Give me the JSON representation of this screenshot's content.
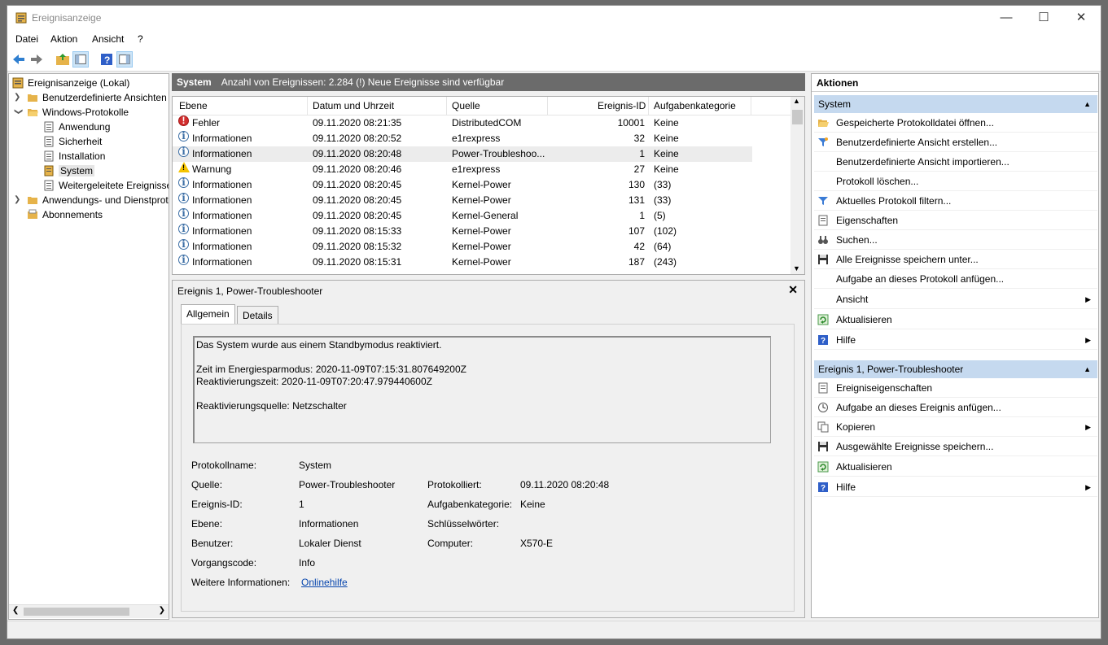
{
  "window": {
    "title": "Ereignisanzeige",
    "minimize": "—",
    "maximize": "☐",
    "close": "✕"
  },
  "menu": [
    "Datei",
    "Aktion",
    "Ansicht",
    "?"
  ],
  "tree": {
    "root": "Ereignisanzeige (Lokal)",
    "custom_views": "Benutzerdefinierte Ansichten",
    "windows_logs": "Windows-Protokolle",
    "logs": [
      "Anwendung",
      "Sicherheit",
      "Installation",
      "System",
      "Weitergeleitete Ereignisse"
    ],
    "app_logs": "Anwendungs- und Dienstprotokolle",
    "subscriptions": "Abonnements"
  },
  "header": {
    "name": "System",
    "count": "Anzahl von Ereignissen: 2.284 (!) Neue Ereignisse sind verfügbar"
  },
  "columns": {
    "level": "Ebene",
    "date": "Datum und Uhrzeit",
    "source": "Quelle",
    "id": "Ereignis-ID",
    "category": "Aufgabenkategorie"
  },
  "events": [
    {
      "level": "Fehler",
      "icon": "error",
      "date": "09.11.2020 08:21:35",
      "source": "DistributedCOM",
      "id": "10001",
      "category": "Keine"
    },
    {
      "level": "Informationen",
      "icon": "info",
      "date": "09.11.2020 08:20:52",
      "source": "e1rexpress",
      "id": "32",
      "category": "Keine"
    },
    {
      "level": "Informationen",
      "icon": "info",
      "date": "09.11.2020 08:20:48",
      "source": "Power-Troubleshoo...",
      "id": "1",
      "category": "Keine"
    },
    {
      "level": "Warnung",
      "icon": "warning",
      "date": "09.11.2020 08:20:46",
      "source": "e1rexpress",
      "id": "27",
      "category": "Keine"
    },
    {
      "level": "Informationen",
      "icon": "info",
      "date": "09.11.2020 08:20:45",
      "source": "Kernel-Power",
      "id": "130",
      "category": "(33)"
    },
    {
      "level": "Informationen",
      "icon": "info",
      "date": "09.11.2020 08:20:45",
      "source": "Kernel-Power",
      "id": "131",
      "category": "(33)"
    },
    {
      "level": "Informationen",
      "icon": "info",
      "date": "09.11.2020 08:20:45",
      "source": "Kernel-General",
      "id": "1",
      "category": "(5)"
    },
    {
      "level": "Informationen",
      "icon": "info",
      "date": "09.11.2020 08:15:33",
      "source": "Kernel-Power",
      "id": "107",
      "category": "(102)"
    },
    {
      "level": "Informationen",
      "icon": "info",
      "date": "09.11.2020 08:15:32",
      "source": "Kernel-Power",
      "id": "42",
      "category": "(64)"
    },
    {
      "level": "Informationen",
      "icon": "info",
      "date": "09.11.2020 08:15:31",
      "source": "Kernel-Power",
      "id": "187",
      "category": "(243)"
    }
  ],
  "detail": {
    "title": "Ereignis 1, Power-Troubleshooter",
    "tabs": [
      "Allgemein",
      "Details"
    ],
    "description": "Das System wurde aus einem Standbymodus reaktiviert.\n\nZeit im Energiesparmodus: 2020-11-09T07:15:31.807649200Z\nReaktivierungszeit: 2020-11-09T07:20:47.979440600Z\n\nReaktivierungsquelle: Netzschalter",
    "labels": {
      "log": "Protokollname:",
      "source": "Quelle:",
      "id": "Ereignis-ID:",
      "level": "Ebene:",
      "user": "Benutzer:",
      "opcode": "Vorgangscode:",
      "more": "Weitere Informationen:",
      "logged": "Protokolliert:",
      "category": "Aufgabenkategorie:",
      "keywords": "Schlüsselwörter:",
      "computer": "Computer:"
    },
    "values": {
      "log": "System",
      "source": "Power-Troubleshooter",
      "id": "1",
      "level": "Informationen",
      "user": "Lokaler Dienst",
      "opcode": "Info",
      "more": "Onlinehilfe",
      "logged": "09.11.2020 08:20:48",
      "category": "Keine",
      "keywords": "",
      "computer": "X570-E"
    }
  },
  "actions": {
    "title": "Aktionen",
    "group1": "System",
    "items1": [
      "Gespeicherte Protokolldatei öffnen...",
      "Benutzerdefinierte Ansicht erstellen...",
      "Benutzerdefinierte Ansicht importieren...",
      "Protokoll löschen...",
      "Aktuelles Protokoll filtern...",
      "Eigenschaften",
      "Suchen...",
      "Alle Ereignisse speichern unter...",
      "Aufgabe an dieses Protokoll anfügen...",
      "Ansicht",
      "Aktualisieren",
      "Hilfe"
    ],
    "group2": "Ereignis 1, Power-Troubleshooter",
    "items2": [
      "Ereigniseigenschaften",
      "Aufgabe an dieses Ereignis anfügen...",
      "Kopieren",
      "Ausgewählte Ereignisse speichern...",
      "Aktualisieren",
      "Hilfe"
    ]
  },
  "colors": {
    "accent": "#c5d9ef",
    "header": "#6b6b6b",
    "link": "#0645ad"
  }
}
